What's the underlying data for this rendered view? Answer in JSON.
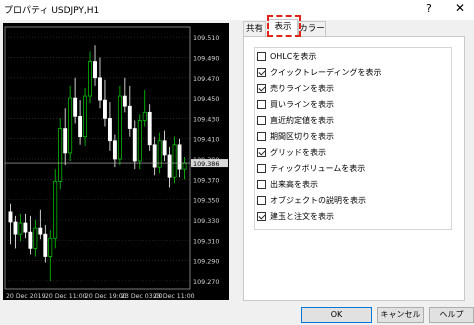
{
  "window": {
    "title": "プロパティ USDJPY,H1",
    "help_label": "?",
    "close_label": "✕"
  },
  "tabs": [
    {
      "label": "共有",
      "active": false
    },
    {
      "label": "表示",
      "active": true
    },
    {
      "label": "カラー",
      "active": false
    }
  ],
  "options": [
    {
      "label": "OHLCを表示",
      "checked": false
    },
    {
      "label": "クイックトレーディングを表示",
      "checked": true
    },
    {
      "label": "売りラインを表示",
      "checked": true
    },
    {
      "label": "買いラインを表示",
      "checked": false
    },
    {
      "label": "直近約定値を表示",
      "checked": false
    },
    {
      "label": "期間区切りを表示",
      "checked": false
    },
    {
      "label": "グリッドを表示",
      "checked": true
    },
    {
      "label": "ティックボリュームを表示",
      "checked": false
    },
    {
      "label": "出来高を表示",
      "checked": false
    },
    {
      "label": "オブジェクトの説明を表示",
      "checked": false
    },
    {
      "label": "建玉と注文を表示",
      "checked": true
    }
  ],
  "buttons": {
    "ok": "OK",
    "cancel": "キャンセル",
    "help": "ヘルプ"
  },
  "chart_data": {
    "type": "candlestick",
    "y_ticks": [
      "109.510",
      "109.490",
      "109.470",
      "109.450",
      "109.430",
      "109.410",
      "109.390",
      "109.370",
      "109.350",
      "109.330",
      "109.310",
      "109.290",
      "109.270"
    ],
    "current_price": "109.386",
    "x_ticks": [
      "20 Dec 2019",
      "20 Dec 11:00",
      "20 Dec 19:00",
      "23 Dec 03:00",
      "23 Dec 11:00"
    ],
    "ylim": [
      109.262,
      109.52
    ],
    "bull_color": "#00d000",
    "bear_color": "#ffffff",
    "grid": true,
    "candles": [
      {
        "o": 109.338,
        "h": 109.346,
        "l": 109.306,
        "c": 109.328
      },
      {
        "o": 109.328,
        "h": 109.334,
        "l": 109.302,
        "c": 109.316
      },
      {
        "o": 109.316,
        "h": 109.336,
        "l": 109.309,
        "c": 109.327
      },
      {
        "o": 109.327,
        "h": 109.336,
        "l": 109.312,
        "c": 109.318
      },
      {
        "o": 109.318,
        "h": 109.334,
        "l": 109.296,
        "c": 109.302
      },
      {
        "o": 109.302,
        "h": 109.33,
        "l": 109.294,
        "c": 109.322
      },
      {
        "o": 109.322,
        "h": 109.34,
        "l": 109.311,
        "c": 109.316
      },
      {
        "o": 109.316,
        "h": 109.325,
        "l": 109.288,
        "c": 109.294
      },
      {
        "o": 109.294,
        "h": 109.32,
        "l": 109.27,
        "c": 109.312
      },
      {
        "o": 109.312,
        "h": 109.38,
        "l": 109.302,
        "c": 109.368
      },
      {
        "o": 109.368,
        "h": 109.43,
        "l": 109.36,
        "c": 109.42
      },
      {
        "o": 109.42,
        "h": 109.44,
        "l": 109.384,
        "c": 109.396
      },
      {
        "o": 109.396,
        "h": 109.462,
        "l": 109.388,
        "c": 109.45
      },
      {
        "o": 109.45,
        "h": 109.47,
        "l": 109.425,
        "c": 109.432
      },
      {
        "o": 109.432,
        "h": 109.448,
        "l": 109.404,
        "c": 109.412
      },
      {
        "o": 109.412,
        "h": 109.46,
        "l": 109.403,
        "c": 109.452
      },
      {
        "o": 109.452,
        "h": 109.496,
        "l": 109.445,
        "c": 109.486
      },
      {
        "o": 109.486,
        "h": 109.502,
        "l": 109.462,
        "c": 109.47
      },
      {
        "o": 109.47,
        "h": 109.49,
        "l": 109.44,
        "c": 109.448
      },
      {
        "o": 109.448,
        "h": 109.468,
        "l": 109.422,
        "c": 109.43
      },
      {
        "o": 109.43,
        "h": 109.446,
        "l": 109.398,
        "c": 109.408
      },
      {
        "o": 109.408,
        "h": 109.414,
        "l": 109.382,
        "c": 109.39
      },
      {
        "o": 109.39,
        "h": 109.462,
        "l": 109.384,
        "c": 109.452
      },
      {
        "o": 109.452,
        "h": 109.47,
        "l": 109.436,
        "c": 109.442
      },
      {
        "o": 109.442,
        "h": 109.462,
        "l": 109.412,
        "c": 109.42
      },
      {
        "o": 109.42,
        "h": 109.428,
        "l": 109.38,
        "c": 109.388
      },
      {
        "o": 109.388,
        "h": 109.434,
        "l": 109.38,
        "c": 109.428
      },
      {
        "o": 109.428,
        "h": 109.458,
        "l": 109.422,
        "c": 109.436
      },
      {
        "o": 109.436,
        "h": 109.444,
        "l": 109.398,
        "c": 109.404
      },
      {
        "o": 109.404,
        "h": 109.412,
        "l": 109.374,
        "c": 109.382
      },
      {
        "o": 109.382,
        "h": 109.416,
        "l": 109.376,
        "c": 109.408
      },
      {
        "o": 109.408,
        "h": 109.418,
        "l": 109.388,
        "c": 109.394
      },
      {
        "o": 109.394,
        "h": 109.402,
        "l": 109.362,
        "c": 109.372
      },
      {
        "o": 109.372,
        "h": 109.412,
        "l": 109.366,
        "c": 109.404
      },
      {
        "o": 109.404,
        "h": 109.41,
        "l": 109.372,
        "c": 109.38
      },
      {
        "o": 109.38,
        "h": 109.392,
        "l": 109.37,
        "c": 109.386
      }
    ]
  }
}
